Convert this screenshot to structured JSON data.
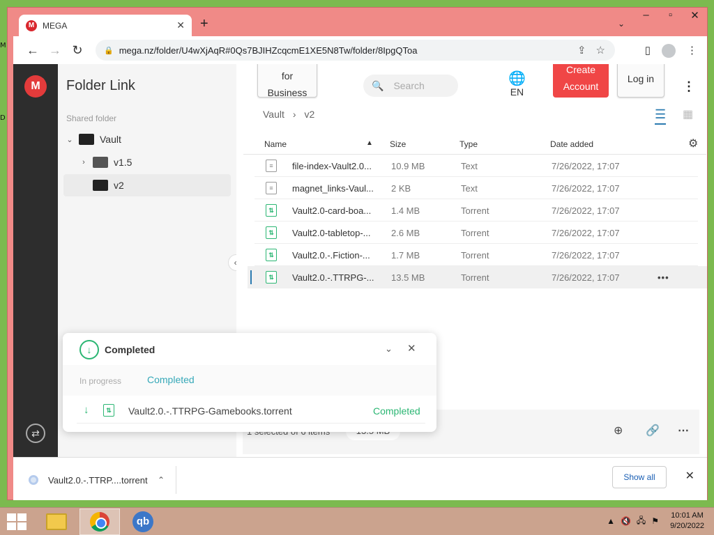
{
  "browser": {
    "tab_title": "MEGA",
    "favicon_letter": "M",
    "url": "mega.nz/folder/U4wXjAqR#0Qs7BJIHZcqcmE1XE5N8Tw/folder/8IpgQToa"
  },
  "sidebar": {
    "title": "Folder Link",
    "shared_label": "Shared folder",
    "tree": [
      {
        "label": "Vault",
        "expanded": true
      },
      {
        "label": "v1.5",
        "expanded": false
      },
      {
        "label": "v2",
        "selected": true
      }
    ]
  },
  "header": {
    "business_label_line": "for",
    "business_label_line2": "Business",
    "search_placeholder": "Search",
    "lang": "EN",
    "create_line1": "Create",
    "create_line2": "Account",
    "login": "Log in"
  },
  "breadcrumb": {
    "root": "Vault",
    "current": "v2"
  },
  "table": {
    "columns": {
      "name": "Name",
      "size": "Size",
      "type": "Type",
      "date": "Date added"
    },
    "rows": [
      {
        "name": "file-index-Vault2.0...",
        "size": "10.9 MB",
        "type": "Text",
        "date": "7/26/2022, 17:07",
        "kind": "text"
      },
      {
        "name": "magnet_links-Vaul...",
        "size": "2 KB",
        "type": "Text",
        "date": "7/26/2022, 17:07",
        "kind": "text"
      },
      {
        "name": "Vault2.0-card-boa...",
        "size": "1.4 MB",
        "type": "Torrent",
        "date": "7/26/2022, 17:07",
        "kind": "torrent"
      },
      {
        "name": "Vault2.0-tabletop-...",
        "size": "2.6 MB",
        "type": "Torrent",
        "date": "7/26/2022, 17:07",
        "kind": "torrent"
      },
      {
        "name": "Vault2.0.-.Fiction-...",
        "size": "1.7 MB",
        "type": "Torrent",
        "date": "7/26/2022, 17:07",
        "kind": "torrent"
      },
      {
        "name": "Vault2.0.-.TTRPG-...",
        "size": "13.5 MB",
        "type": "Torrent",
        "date": "7/26/2022, 17:07",
        "kind": "torrent",
        "selected": true
      }
    ]
  },
  "selection": {
    "text": "1 selected of 6 items",
    "size": "13.5 MB"
  },
  "transfer": {
    "title": "Completed",
    "tab_inprogress": "In progress",
    "tab_completed": "Completed",
    "item_name": "Vault2.0.-.TTRPG-Gamebooks.torrent",
    "item_status": "Completed"
  },
  "downloads": {
    "item": "Vault2.0.-.TTRP....torrent",
    "show_all": "Show all"
  },
  "taskbar": {
    "qb_label": "qb",
    "time": "10:01 AM",
    "date": "9/20/2022"
  },
  "desktop": {
    "letters": [
      "M",
      "D"
    ]
  },
  "colors": {
    "accent": "#f04646",
    "completed": "#2bb673",
    "tab_active": "#35a8b8",
    "window_frame": "#f08a87"
  }
}
